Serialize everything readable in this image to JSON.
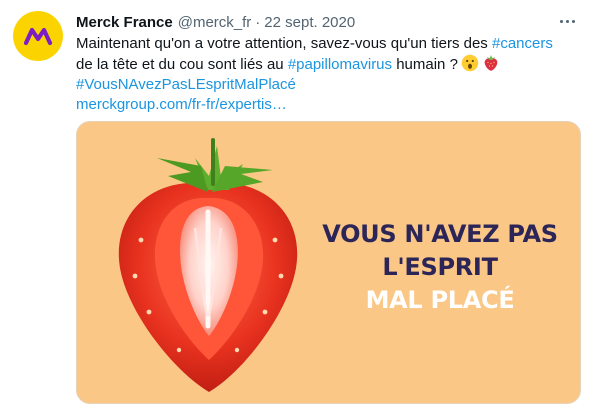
{
  "tweet": {
    "author_name": "Merck France",
    "handle": "@merck_fr",
    "separator": "·",
    "date": "22 sept. 2020",
    "text_line1_prefix": "Maintenant qu'on a votre attention, savez-vous qu'un tiers des ",
    "hashtag_cancers": "#cancers",
    "text_line2_prefix": "de la tête et du cou sont liés au ",
    "hashtag_papillomavirus": "#papillomavirus",
    "text_line2_suffix": " humain ?",
    "hashtag_campaign": "#VousNAvezPasLEspritMalPlacé",
    "link": "merckgroup.com/fr-fr/expertis…",
    "emojis": [
      "face-with-open-mouth",
      "strawberry"
    ]
  },
  "media": {
    "headline_line1": "VOUS N'AVEZ PAS",
    "headline_line2": "L'ESPRIT",
    "headline_line3": "MAL PLACÉ",
    "background_color": "#fbc786",
    "headline_dark_color": "#2c2557",
    "headline_light_color": "#ffffff"
  },
  "colors": {
    "avatar_bg": "#fbd400",
    "logo_color": "#7b1fc4",
    "link_color": "#1b95e0",
    "muted_text": "#536471"
  }
}
